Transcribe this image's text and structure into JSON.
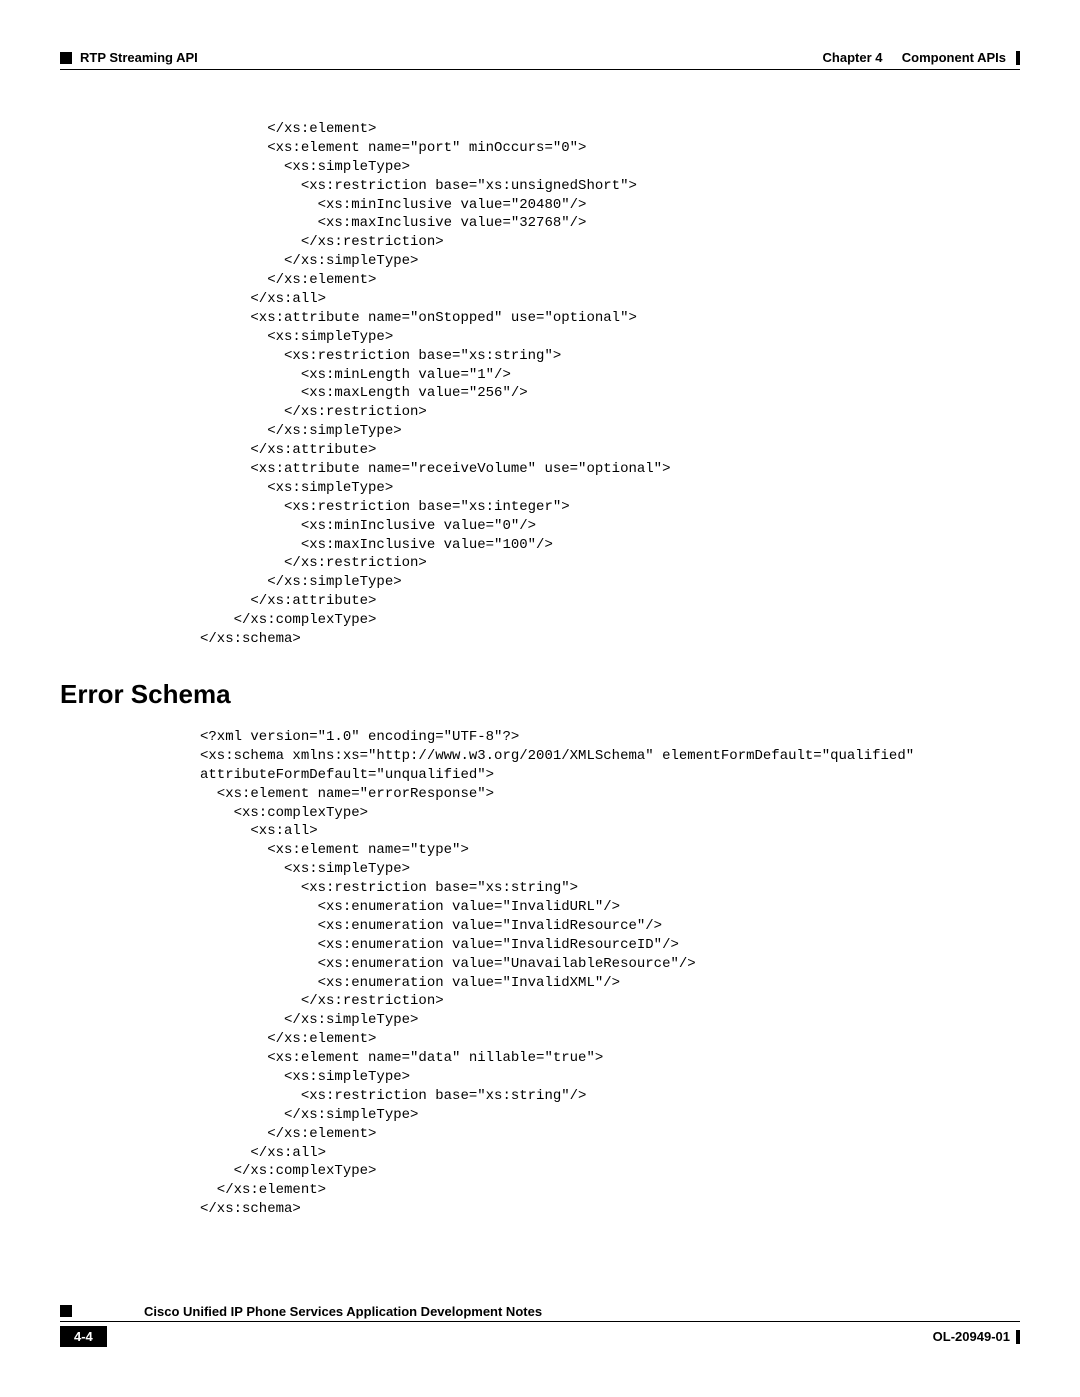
{
  "header": {
    "chapter_label": "Chapter 4",
    "chapter_name": "Component APIs",
    "section_label": "RTP Streaming API"
  },
  "code_block_1": "        </xs:element>\n        <xs:element name=\"port\" minOccurs=\"0\">\n          <xs:simpleType>\n            <xs:restriction base=\"xs:unsignedShort\">\n              <xs:minInclusive value=\"20480\"/>\n              <xs:maxInclusive value=\"32768\"/>\n            </xs:restriction>\n          </xs:simpleType>\n        </xs:element>\n      </xs:all>\n      <xs:attribute name=\"onStopped\" use=\"optional\">\n        <xs:simpleType>\n          <xs:restriction base=\"xs:string\">\n            <xs:minLength value=\"1\"/>\n            <xs:maxLength value=\"256\"/>\n          </xs:restriction>\n        </xs:simpleType>\n      </xs:attribute>\n      <xs:attribute name=\"receiveVolume\" use=\"optional\">\n        <xs:simpleType>\n          <xs:restriction base=\"xs:integer\">\n            <xs:minInclusive value=\"0\"/>\n            <xs:maxInclusive value=\"100\"/>\n          </xs:restriction>\n        </xs:simpleType>\n      </xs:attribute>\n    </xs:complexType>\n</xs:schema>",
  "section_heading": "Error Schema",
  "code_block_2": "<?xml version=\"1.0\" encoding=\"UTF-8\"?>\n<xs:schema xmlns:xs=\"http://www.w3.org/2001/XMLSchema\" elementFormDefault=\"qualified\" \nattributeFormDefault=\"unqualified\">\n  <xs:element name=\"errorResponse\">\n    <xs:complexType>\n      <xs:all>\n        <xs:element name=\"type\">\n          <xs:simpleType>\n            <xs:restriction base=\"xs:string\">\n              <xs:enumeration value=\"InvalidURL\"/>\n              <xs:enumeration value=\"InvalidResource\"/>\n              <xs:enumeration value=\"InvalidResourceID\"/>\n              <xs:enumeration value=\"UnavailableResource\"/>\n              <xs:enumeration value=\"InvalidXML\"/>\n            </xs:restriction>\n          </xs:simpleType>\n        </xs:element>\n        <xs:element name=\"data\" nillable=\"true\">\n          <xs:simpleType>\n            <xs:restriction base=\"xs:string\"/>\n          </xs:simpleType>\n        </xs:element>\n      </xs:all>\n    </xs:complexType>\n  </xs:element>\n</xs:schema>",
  "footer": {
    "book_title": "Cisco Unified IP Phone Services Application Development Notes",
    "page_number": "4-4",
    "doc_id": "OL-20949-01"
  }
}
